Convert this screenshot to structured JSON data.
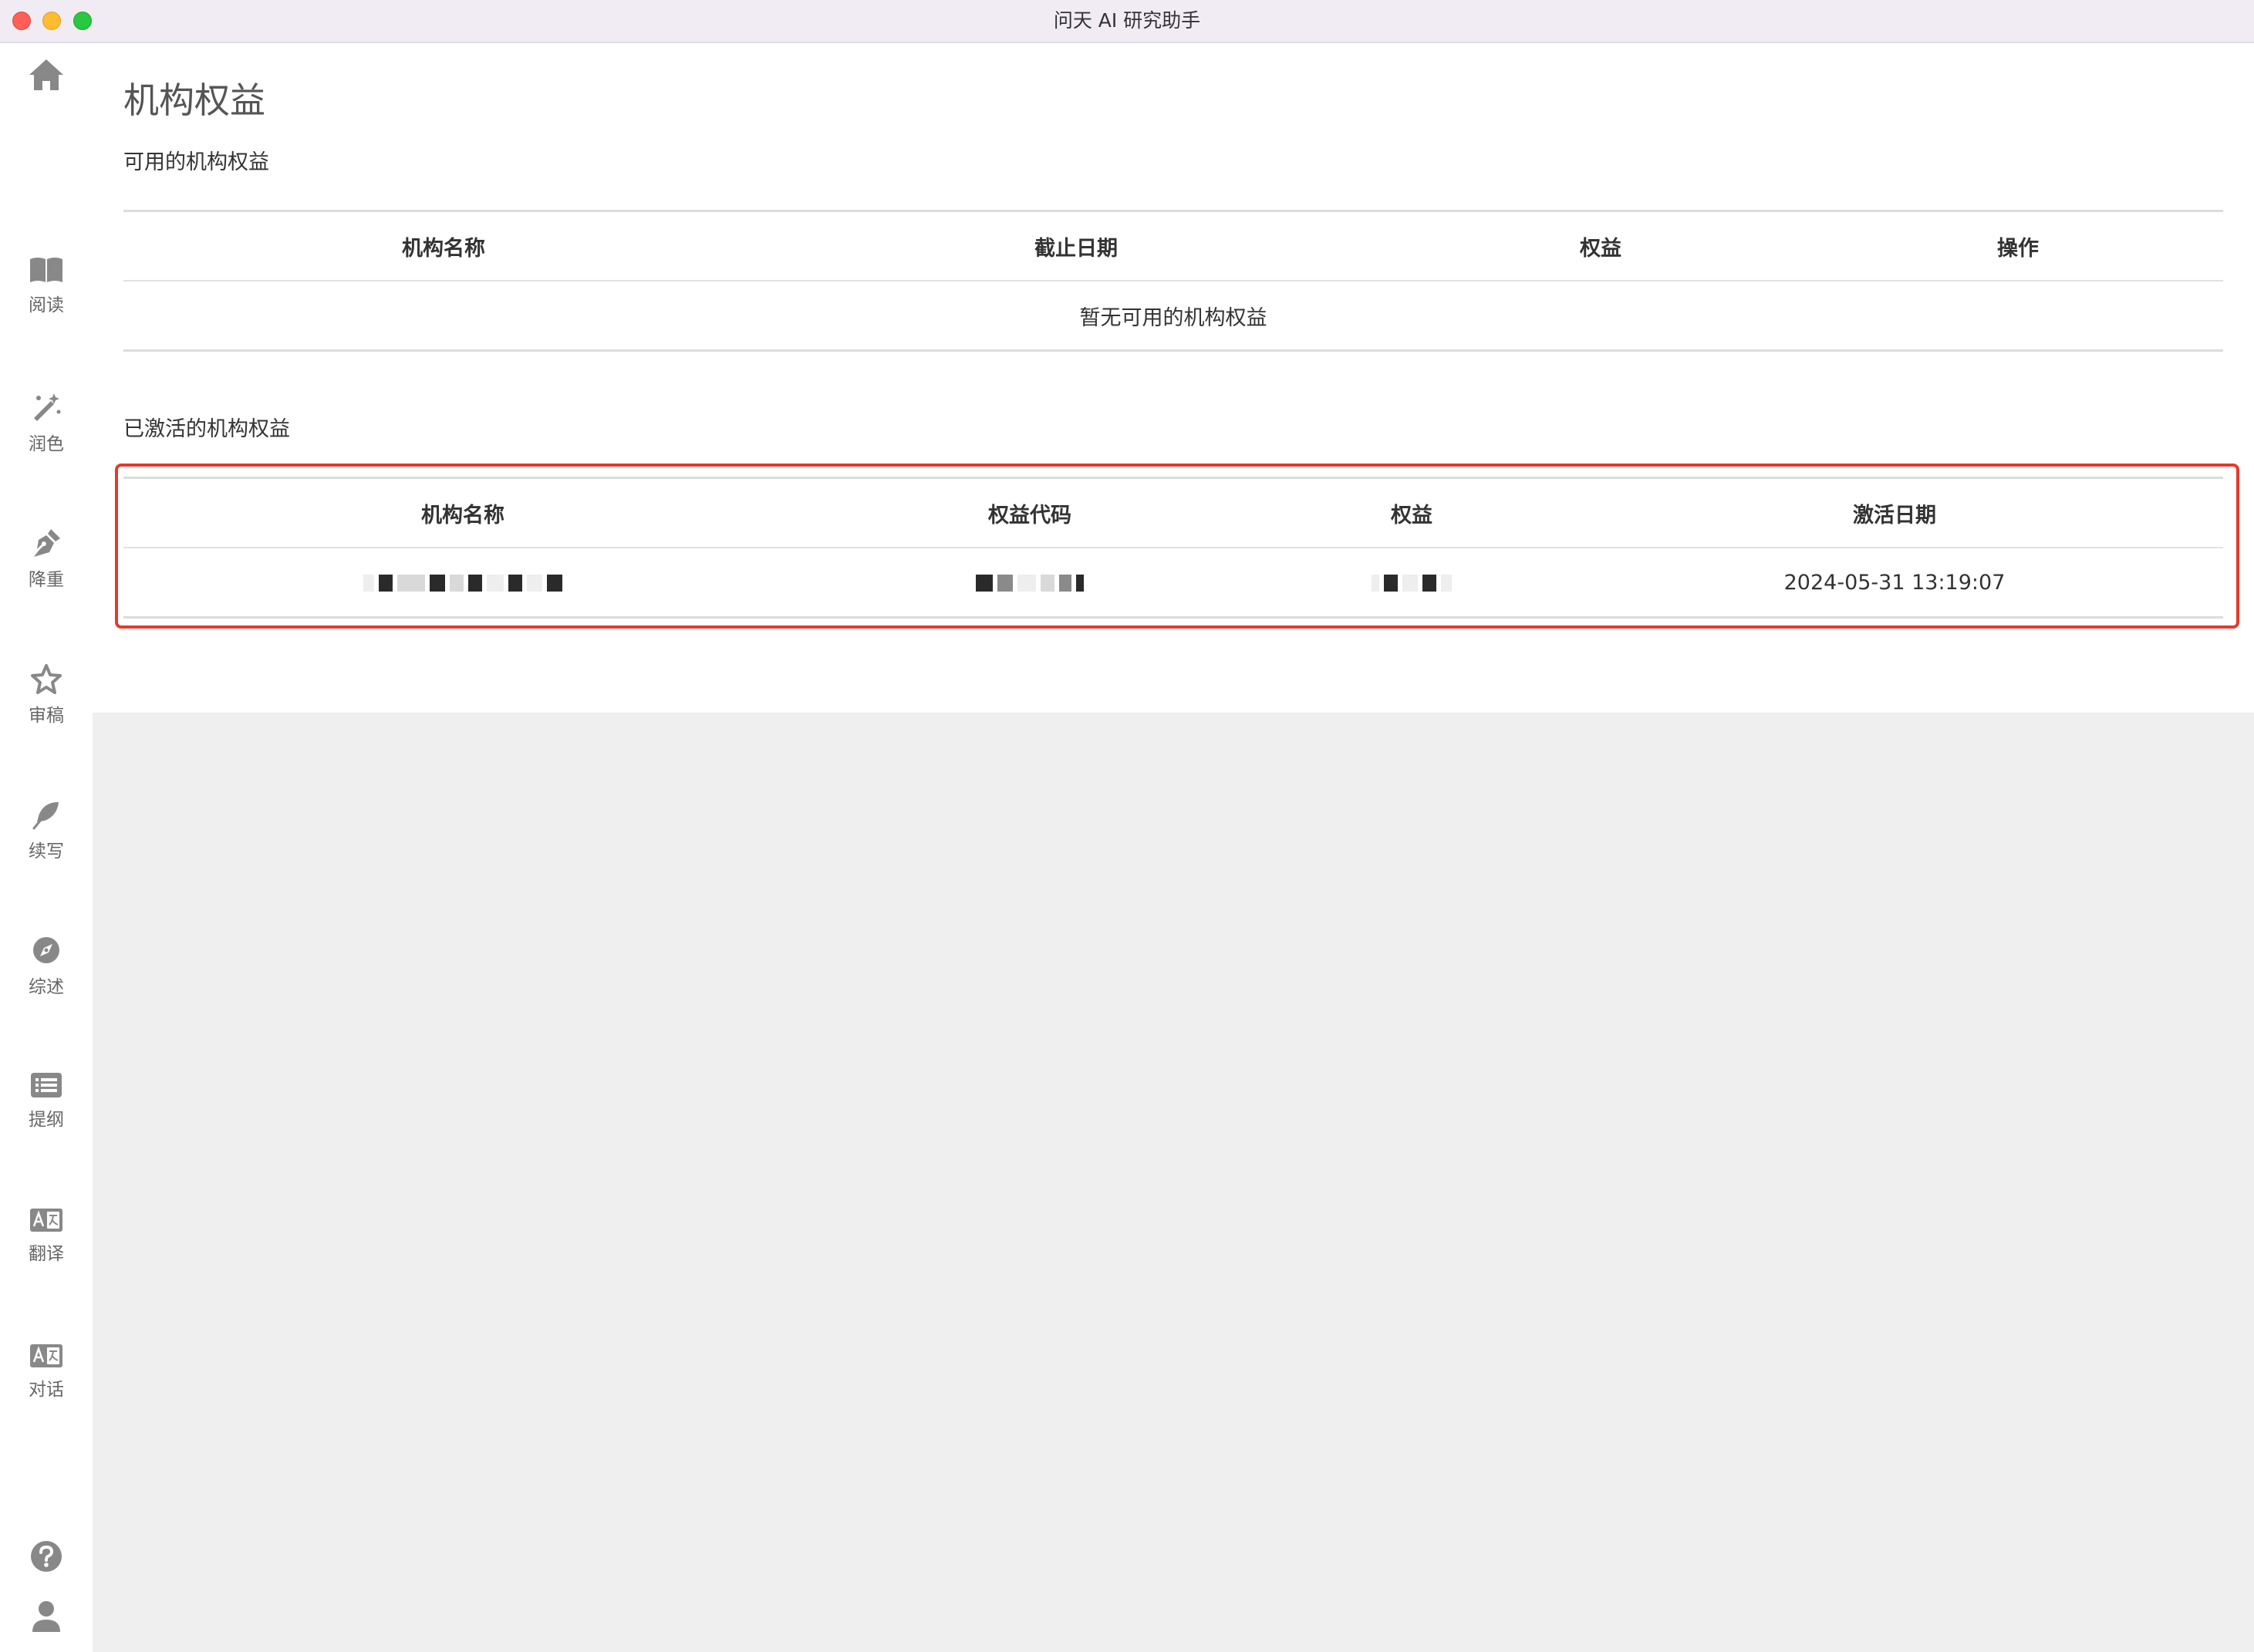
{
  "window": {
    "title": "问天 AI 研究助手"
  },
  "sidebar": {
    "items": [
      {
        "label": "阅读",
        "icon": "book-icon"
      },
      {
        "label": "润色",
        "icon": "magic-wand-icon"
      },
      {
        "label": "降重",
        "icon": "pen-nib-icon"
      },
      {
        "label": "审稿",
        "icon": "star-icon"
      },
      {
        "label": "续写",
        "icon": "feather-icon"
      },
      {
        "label": "综述",
        "icon": "compass-icon"
      },
      {
        "label": "提纲",
        "icon": "list-icon"
      },
      {
        "label": "翻译",
        "icon": "translate-icon"
      },
      {
        "label": "对话",
        "icon": "translate-icon"
      }
    ],
    "home_icon": "home-icon",
    "help_icon": "help-icon",
    "user_icon": "user-icon"
  },
  "page": {
    "title": "机构权益",
    "available": {
      "title": "可用的机构权益",
      "headers": [
        "机构名称",
        "截止日期",
        "权益",
        "操作"
      ],
      "empty_text": "暂无可用的机构权益"
    },
    "activated": {
      "title": "已激活的机构权益",
      "headers": [
        "机构名称",
        "权益代码",
        "权益",
        "激活日期"
      ],
      "rows": [
        {
          "activation_date": "2024-05-31 13:19:07"
        }
      ]
    }
  },
  "colors": {
    "highlight_border": "#e33b2e",
    "gray_area": "#efefef",
    "icon_gray": "#888888"
  }
}
